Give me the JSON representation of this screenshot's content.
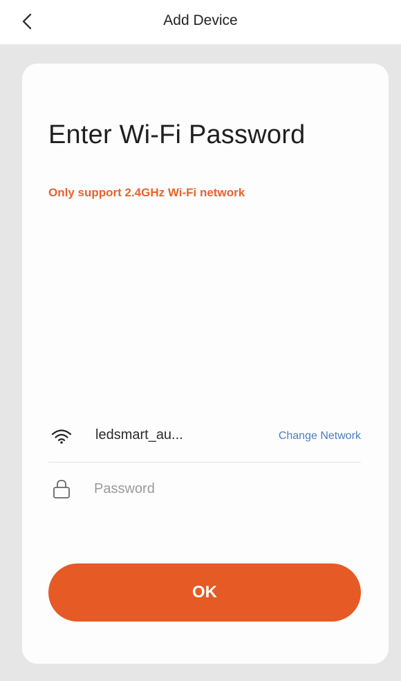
{
  "header": {
    "title": "Add Device",
    "back_icon": "chevron-left-icon"
  },
  "card": {
    "heading": "Enter Wi-Fi Password",
    "note": "Only support 2.4GHz Wi-Fi network",
    "note_color": "#e8622d"
  },
  "network": {
    "icon": "wifi-icon",
    "ssid": "ledsmart_au...",
    "change_label": "Change Network",
    "link_color": "#4a7ebd"
  },
  "password": {
    "icon": "lock-icon",
    "placeholder": "Password",
    "value": ""
  },
  "actions": {
    "ok_label": "OK",
    "button_color": "#e55a25"
  }
}
